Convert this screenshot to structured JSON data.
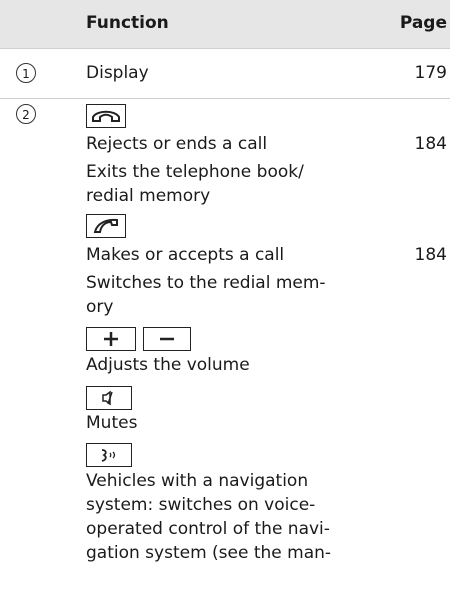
{
  "header": {
    "function_label": "Function",
    "page_label": "Page"
  },
  "row1": {
    "number": "1",
    "function": "Display",
    "page": "179"
  },
  "row2": {
    "number": "2",
    "end_call_text1": "Rejects or ends a call",
    "end_call_page": "184",
    "end_call_text2_line1": "Exits the telephone book/",
    "end_call_text2_line2": "redial memory",
    "accept_text1": "Makes or accepts a call",
    "accept_page": "184",
    "accept_text2_line1": "Switches to the redial mem-",
    "accept_text2_line2": "ory",
    "volume_text": "Adjusts the volume",
    "mute_text": "Mutes",
    "voice_line1": "Vehicles with a navigation",
    "voice_line2": "system: switches on voice-",
    "voice_line3": "operated control of the navi-",
    "voice_line4": "gation system (see the man-"
  }
}
